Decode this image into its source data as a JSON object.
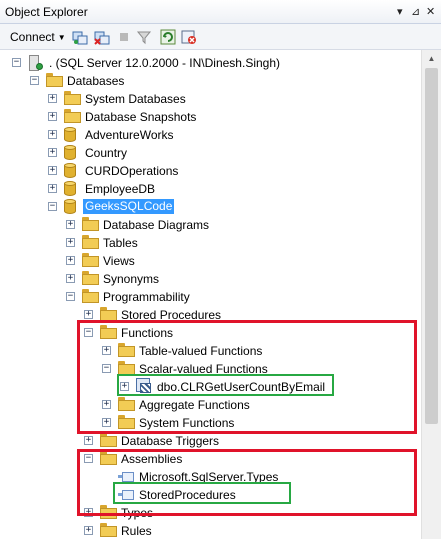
{
  "window": {
    "title": "Object Explorer"
  },
  "titlebar_buttons": [
    "▾",
    "⊿",
    "✕"
  ],
  "toolbar": {
    "connect_label": "Connect",
    "icons": [
      "connect-object-explorer-icon",
      "disconnect-icon",
      "stop-icon",
      "filter-icon",
      "refresh-icon",
      "activity-monitor-icon"
    ]
  },
  "tree": [
    {
      "level": 0,
      "expand": "−",
      "icon": "server",
      "label": ". (SQL Server 12.0.2000 - IN\\Dinesh.Singh)",
      "name": "tree-node-server"
    },
    {
      "level": 1,
      "expand": "−",
      "icon": "folder",
      "label": "Databases",
      "name": "tree-node-databases"
    },
    {
      "level": 2,
      "expand": "+",
      "icon": "folder",
      "label": "System Databases",
      "name": "tree-node-system-databases"
    },
    {
      "level": 2,
      "expand": "+",
      "icon": "folder",
      "label": "Database Snapshots",
      "name": "tree-node-database-snapshots"
    },
    {
      "level": 2,
      "expand": "+",
      "icon": "db",
      "label": "AdventureWorks",
      "name": "tree-node-db-adventureworks"
    },
    {
      "level": 2,
      "expand": "+",
      "icon": "db",
      "label": "Country",
      "name": "tree-node-db-country"
    },
    {
      "level": 2,
      "expand": "+",
      "icon": "db",
      "label": "CURDOperations",
      "name": "tree-node-db-curdoperations"
    },
    {
      "level": 2,
      "expand": "+",
      "icon": "db",
      "label": "EmployeeDB",
      "name": "tree-node-db-employeedb"
    },
    {
      "level": 2,
      "expand": "−",
      "icon": "db",
      "label": "GeeksSQLCode",
      "name": "tree-node-db-geekssqlcode",
      "selected": true
    },
    {
      "level": 3,
      "expand": "+",
      "icon": "folder",
      "label": "Database Diagrams",
      "name": "tree-node-database-diagrams"
    },
    {
      "level": 3,
      "expand": "+",
      "icon": "folder",
      "label": "Tables",
      "name": "tree-node-tables"
    },
    {
      "level": 3,
      "expand": "+",
      "icon": "folder",
      "label": "Views",
      "name": "tree-node-views"
    },
    {
      "level": 3,
      "expand": "+",
      "icon": "folder",
      "label": "Synonyms",
      "name": "tree-node-synonyms"
    },
    {
      "level": 3,
      "expand": "−",
      "icon": "folder",
      "label": "Programmability",
      "name": "tree-node-programmability"
    },
    {
      "level": 4,
      "expand": "+",
      "icon": "folder",
      "label": "Stored Procedures",
      "name": "tree-node-stored-procedures"
    },
    {
      "level": 4,
      "expand": "−",
      "icon": "folder",
      "label": "Functions",
      "name": "tree-node-functions"
    },
    {
      "level": 5,
      "expand": "+",
      "icon": "folder",
      "label": "Table-valued Functions",
      "name": "tree-node-table-valued-functions"
    },
    {
      "level": 5,
      "expand": "−",
      "icon": "folder",
      "label": "Scalar-valued Functions",
      "name": "tree-node-scalar-valued-functions"
    },
    {
      "level": 6,
      "expand": "+",
      "icon": "fn",
      "label": "dbo.CLRGetUserCountByEmail",
      "name": "tree-node-fn-clrgetusercountbyemail"
    },
    {
      "level": 5,
      "expand": "+",
      "icon": "folder",
      "label": "Aggregate Functions",
      "name": "tree-node-aggregate-functions"
    },
    {
      "level": 5,
      "expand": "+",
      "icon": "folder",
      "label": "System Functions",
      "name": "tree-node-system-functions"
    },
    {
      "level": 4,
      "expand": "+",
      "icon": "folder",
      "label": "Database Triggers",
      "name": "tree-node-database-triggers"
    },
    {
      "level": 4,
      "expand": "−",
      "icon": "folder",
      "label": "Assemblies",
      "name": "tree-node-assemblies"
    },
    {
      "level": 5,
      "expand": "",
      "icon": "asm",
      "label": "Microsoft.SqlServer.Types",
      "name": "tree-node-asm-microsoft-sqlserver-types"
    },
    {
      "level": 5,
      "expand": "",
      "icon": "asm",
      "label": "StoredProcedures",
      "name": "tree-node-asm-storedprocedures"
    },
    {
      "level": 4,
      "expand": "+",
      "icon": "folder",
      "label": "Types",
      "name": "tree-node-types"
    },
    {
      "level": 4,
      "expand": "+",
      "icon": "folder",
      "label": "Rules",
      "name": "tree-node-rules"
    }
  ],
  "colors": {
    "selection": "#3399ff",
    "highlight_red": "#e0132a",
    "highlight_green": "#27a843"
  }
}
